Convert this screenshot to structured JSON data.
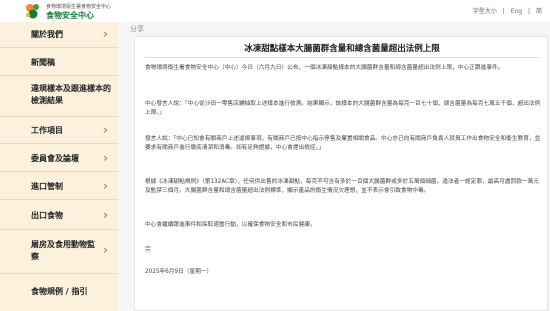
{
  "header": {
    "logo_line1": "食物環境衞生署食物安全中心",
    "logo_line2": "食物安全中心",
    "font_size": "字型大小",
    "lang_en": "Eng",
    "lang_sc": "简"
  },
  "sidebar": {
    "items": [
      {
        "label": "關於我們",
        "chevron": true
      },
      {
        "label": "新聞稿",
        "chevron": false
      },
      {
        "label": "違規樣本及跟進樣本的檢測結果",
        "chevron": false
      },
      {
        "label": "工作項目",
        "chevron": true
      },
      {
        "label": "委員會及論壇",
        "chevron": true
      },
      {
        "label": "進口管制",
        "chevron": true
      },
      {
        "label": "出口食物",
        "chevron": true
      },
      {
        "label": "屠房及食用動物監察",
        "chevron": true
      },
      {
        "label": "食物規例 / 指引",
        "chevron": false
      }
    ]
  },
  "breadcrumb": {
    "label": "分享"
  },
  "article": {
    "title": "冰凍甜點樣本大腸菌群含量和總含菌量超出法例上限",
    "paragraphs": [
      "食物環境衞生署食物安全中心（中心）今日（六月九日）公布，一個冰凍甜點樣本的大腸菌群含量和總含菌量超出法例上限，中心正跟進事件。",
      "中心發言人說：「中心從沙田一零售店舖抽取上述樣本進行檢測。結果顯示，該樣本的大腸菌群含量為每克一百七十個，總含菌量為每克七萬五千個，超出法例上限。」",
      "發言人說：「中心已知會有關商戶上述違規事項，有關商戶已按中心指示停售及棄置相關食品。中心亦已向有關商戶負責人就員工作出食物安全和衞生教育，並要求有關商戶進行徹底清潔和消毒。如有足夠證據，中心會提出檢控。」",
      "根據《冰凍甜點規例》（第132AC章），任何供出售的冰凍甜點，每克不可含有多於一百個大腸菌群或多於五萬個細菌。違法者一經定罪，最高可處罰款一萬元及監禁三個月。大腸菌群含量和總含菌量超出法例標準，顯示產品的衞生情況欠理想，並不表示會引致食物中毒。",
      "中心會繼續跟進事件和採取適當行動，以確保食物安全和市民健康。",
      "完",
      "2025年6月9日（星期一）"
    ]
  }
}
